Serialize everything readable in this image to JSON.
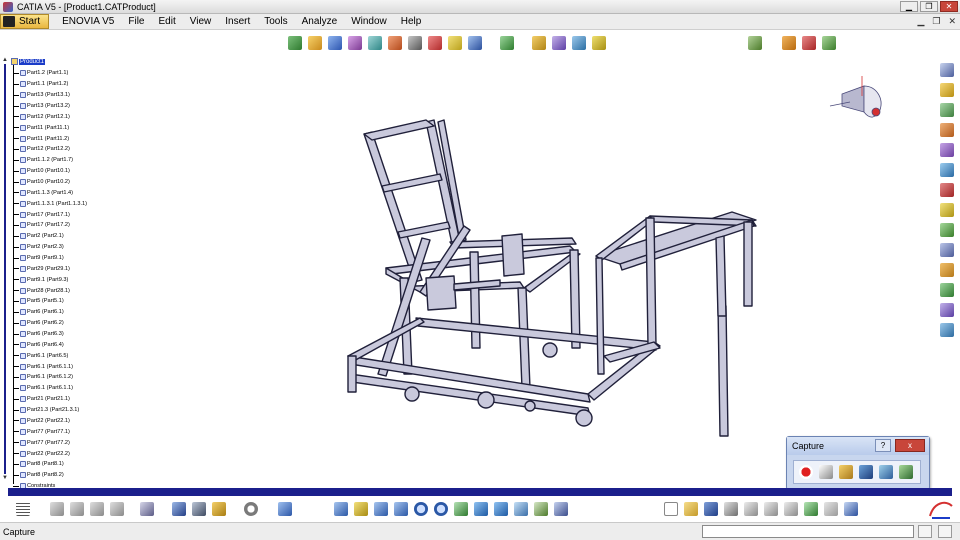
{
  "window": {
    "title": "CATIA V5 - [Product1.CATProduct]"
  },
  "menu": {
    "start": "Start",
    "items": [
      "ENOVIA V5",
      "File",
      "Edit",
      "View",
      "Insert",
      "Tools",
      "Analyze",
      "Window",
      "Help"
    ]
  },
  "tree": {
    "root": "Product1",
    "items": [
      "Part1.2 (Part1.1)",
      "Part1.1 (Part1.2)",
      "Part13 (Part13.1)",
      "Part13 (Part13.2)",
      "Part12 (Part12.1)",
      "Part11 (Part11.1)",
      "Part11 (Part11.2)",
      "Part12 (Part12.2)",
      "Part1.1.2 (Part1.7)",
      "Part10 (Part10.1)",
      "Part10 (Part10.2)",
      "Part1.1.3 (Part1.4)",
      "Part1.1.3.1 (Part1.1.3.1)",
      "Part17 (Part17.1)",
      "Part17 (Part17.2)",
      "Part2 (Part2.1)",
      "Part2 (Part2.3)",
      "Part9 (Part9.1)",
      "Part29 (Part29.1)",
      "Part9.1 (Part9.3)",
      "Part28 (Part28.1)",
      "Part5 (Part5.1)",
      "Part6 (Part6.1)",
      "Part6 (Part6.2)",
      "Part6 (Part6.3)",
      "Part6 (Part6.4)",
      "Part6.1 (Part6.5)",
      "Part6.1 (Part6.1.1)",
      "Part6.1 (Part6.1.2)",
      "Part6.1 (Part6.1.1)",
      "Part21 (Part21.1)",
      "Part21.3 (Part21.3.1)",
      "Part22 (Part22.1)",
      "Part77 (Part77.1)",
      "Part77 (Part77.2)",
      "Part22 (Part22.2)",
      "Part8 (Part8.1)",
      "Part8 (Part8.2)",
      "Constraints"
    ]
  },
  "capture": {
    "title": "Capture",
    "help": "?",
    "close": "x"
  },
  "status": {
    "text": "Capture"
  },
  "colors": {
    "tree_highlight": "#1b3cc8",
    "scroll_blue": "#1b1f8c",
    "frame_fill": "#c9c9dc",
    "frame_stroke": "#20203a"
  }
}
